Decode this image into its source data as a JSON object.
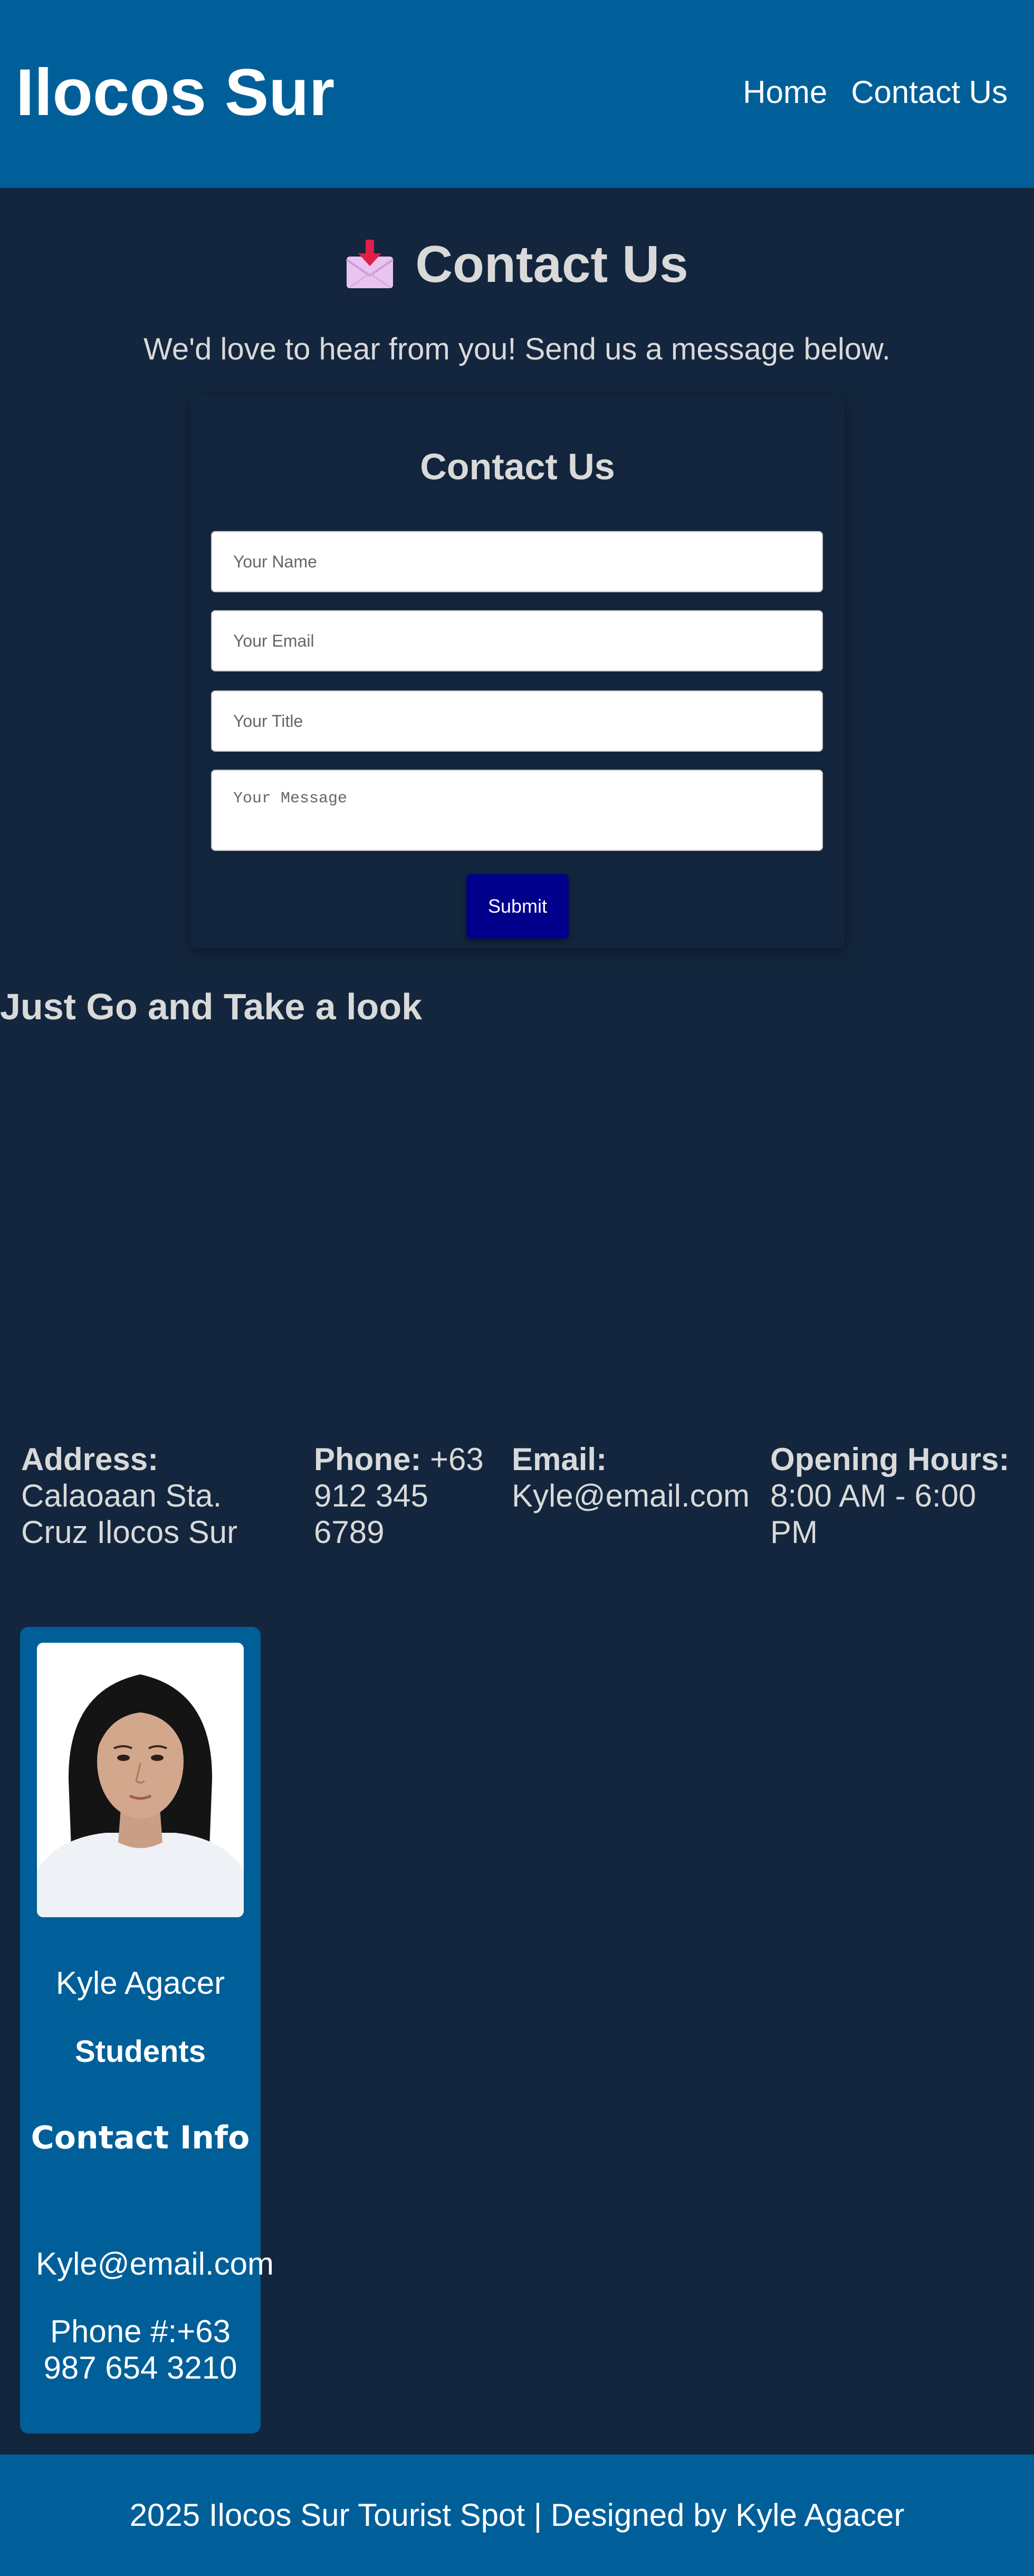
{
  "header": {
    "site_title": "Ilocos Sur",
    "nav": [
      {
        "label": "Home"
      },
      {
        "label": "Contact Us"
      }
    ]
  },
  "page": {
    "heading": "Contact Us",
    "heading_icon": "envelope-download-icon",
    "intro": "We'd love to hear from you! Send us a message below."
  },
  "form": {
    "title": "Contact Us",
    "name_placeholder": "Your Name",
    "email_placeholder": "Your Email",
    "title_placeholder": "Your Title",
    "message_placeholder": "Your Message",
    "submit_label": "Submit"
  },
  "look": {
    "heading": "Just Go and Take a look"
  },
  "info": {
    "address_label": "Address:",
    "address_value": "Calaoaan Sta. Cruz Ilocos Sur",
    "phone_label": "Phone:",
    "phone_value": "+63 912 345 6789",
    "email_label": "Email:",
    "email_value": "Kyle@email.com",
    "hours_label": "Opening Hours:",
    "hours_value": "8:00 AM - 6:00 PM"
  },
  "profile": {
    "photo_icon": "profile-photo",
    "name": "Kyle Agacer",
    "role": "Students",
    "contact_title": "Contact Info",
    "email": "Kyle@email.com",
    "phone": "Phone #:+63 987 654 3210"
  },
  "footer": {
    "text": "2025 Ilocos Sur Tourist Spot | Designed by Kyle Agacer"
  },
  "colors": {
    "page_bg": "#13263d",
    "header_bg": "#005f99",
    "submit_bg": "#00008b",
    "text_light": "#d9d9d9"
  }
}
